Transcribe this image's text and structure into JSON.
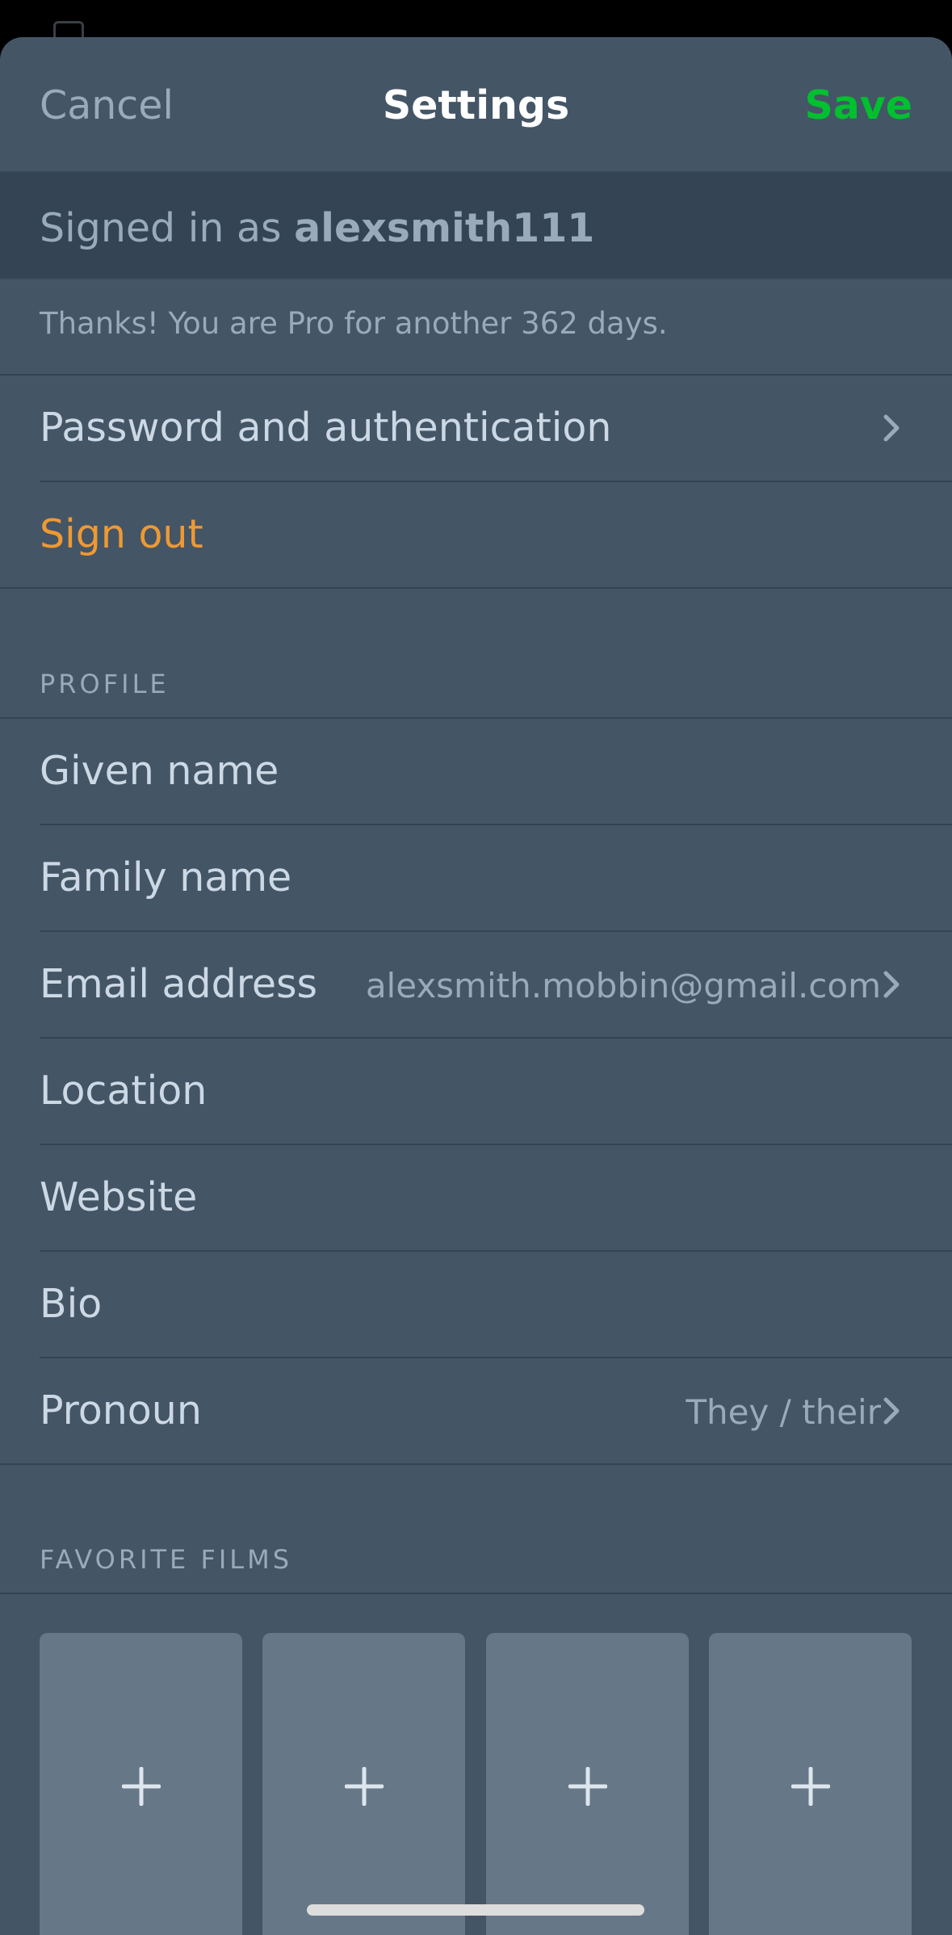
{
  "header": {
    "cancel_label": "Cancel",
    "title": "Settings",
    "save_label": "Save"
  },
  "account": {
    "signed_in_prefix": "Signed in as",
    "username": "alexsmith111",
    "pro_message": "Thanks! You are Pro for another 362 days.",
    "password_label": "Password and authentication",
    "sign_out_label": "Sign out"
  },
  "profile": {
    "section_title": "PROFILE",
    "fields": [
      {
        "label": "Given name",
        "value": ""
      },
      {
        "label": "Family name",
        "value": ""
      },
      {
        "label": "Email address",
        "value": "alexsmith.mobbin@gmail.com"
      },
      {
        "label": "Location",
        "value": ""
      },
      {
        "label": "Website",
        "value": ""
      },
      {
        "label": "Bio",
        "value": ""
      },
      {
        "label": "Pronoun",
        "value": "They / their"
      }
    ]
  },
  "favorite_films": {
    "section_title": "FAVORITE FILMS",
    "slots": [
      {
        "icon": "plus-icon"
      },
      {
        "icon": "plus-icon"
      },
      {
        "icon": "plus-icon"
      },
      {
        "icon": "plus-icon"
      }
    ]
  },
  "icons": {
    "chevron": "chevron-right-icon",
    "plus": "plus-icon"
  },
  "colors": {
    "background": "#445566",
    "banner": "#344454",
    "save_green": "#00c030",
    "sign_out_orange": "#ee9933",
    "muted_text": "#99aabb",
    "film_slot": "#667788"
  }
}
